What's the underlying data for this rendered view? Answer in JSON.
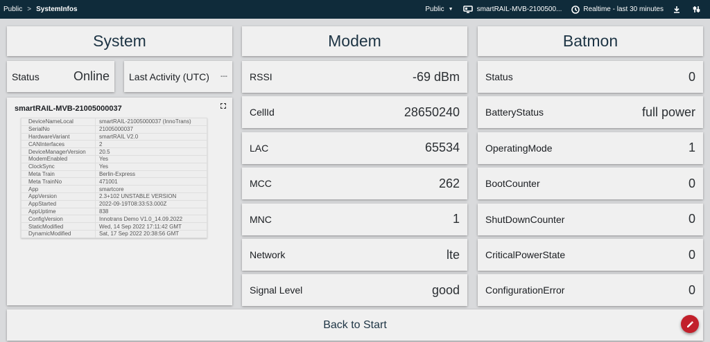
{
  "topbar": {
    "breadcrumb_root": "Public",
    "breadcrumb_sep": ">",
    "breadcrumb_current": "SystemInfos",
    "scope": "Public",
    "device": "smartRAIL-MVB-2100500...",
    "timerange": "Realtime - last 30 minutes"
  },
  "system": {
    "header": "System",
    "status_label": "Status",
    "status_value": "Online",
    "activity_label": "Last Activity (UTC)",
    "activity_value": "---",
    "info_title": "smartRAIL-MVB-21005000037",
    "info_rows": [
      {
        "key": "DeviceNameLocal",
        "value": "smartRAIL-21005000037 (InnoTrans)"
      },
      {
        "key": "SerialNo",
        "value": "21005000037"
      },
      {
        "key": "HardwareVariant",
        "value": "smartRAIL V2.0"
      },
      {
        "key": "CANInterfaces",
        "value": "2"
      },
      {
        "key": "DeviceManagerVersion",
        "value": "20.5"
      },
      {
        "key": "ModemEnabled",
        "value": "Yes"
      },
      {
        "key": "ClockSync",
        "value": "Yes"
      },
      {
        "key": "Meta Train",
        "value": "Berlin-Express"
      },
      {
        "key": "Meta TrainNo",
        "value": "471001"
      },
      {
        "key": "App",
        "value": "smartcore"
      },
      {
        "key": "AppVersion",
        "value": "2.3+102 UNSTABLE VERSION"
      },
      {
        "key": "AppStarted",
        "value": "2022-09-19T08:33:53.000Z"
      },
      {
        "key": "AppUptime",
        "value": "838"
      },
      {
        "key": "ConfigVersion",
        "value": "Innotrans Demo V1.0_14.09.2022"
      },
      {
        "key": "StaticModified",
        "value": "Wed, 14 Sep 2022 17:11:42 GMT"
      },
      {
        "key": "DynamicModified",
        "value": "Sat, 17 Sep 2022 20:38:56 GMT"
      }
    ]
  },
  "modem": {
    "header": "Modem",
    "rows": [
      {
        "label": "RSSI",
        "value": "-69 dBm"
      },
      {
        "label": "CellId",
        "value": "28650240"
      },
      {
        "label": "LAC",
        "value": "65534"
      },
      {
        "label": "MCC",
        "value": "262"
      },
      {
        "label": "MNC",
        "value": "1"
      },
      {
        "label": "Network",
        "value": "lte"
      },
      {
        "label": "Signal Level",
        "value": "good"
      }
    ]
  },
  "batmon": {
    "header": "Batmon",
    "rows": [
      {
        "label": "Status",
        "value": "0"
      },
      {
        "label": "BatteryStatus",
        "value": "full power"
      },
      {
        "label": "OperatingMode",
        "value": "1"
      },
      {
        "label": "BootCounter",
        "value": "0"
      },
      {
        "label": "ShutDownCounter",
        "value": "0"
      },
      {
        "label": "CriticalPowerState",
        "value": "0"
      },
      {
        "label": "ConfigurationError",
        "value": "0"
      }
    ]
  },
  "footer": {
    "back_label": "Back to Start"
  },
  "icons": {
    "device": "monitor-icon",
    "clock": "clock-icon",
    "download": "download-icon",
    "settings": "sliders-icon",
    "expand": "expand-icon",
    "edit": "pencil-icon"
  },
  "colors": {
    "topbar": "#0f2b3a",
    "card": "#f0f0f0",
    "background": "#d9dadc",
    "fab": "#c2202b"
  }
}
